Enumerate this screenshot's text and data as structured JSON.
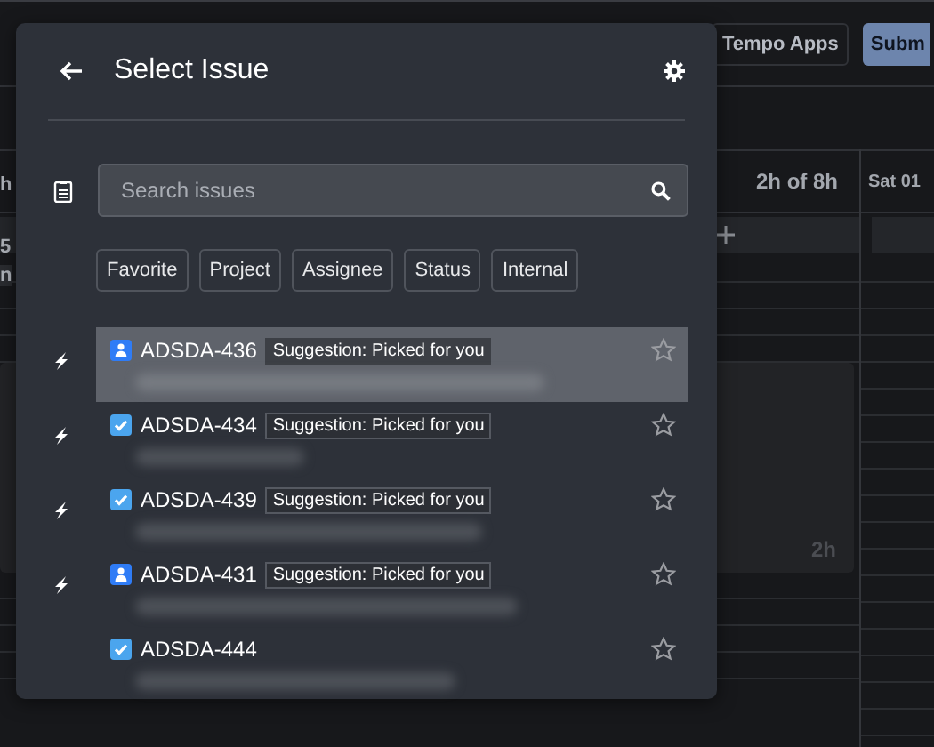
{
  "background": {
    "tempo_button": "Tempo Apps",
    "submit_button": "Subm",
    "left_fragments": [
      "h",
      "5",
      "n"
    ],
    "day_total": "2h of 8h",
    "day_column": "Sat 01",
    "entry_duration": "2h"
  },
  "dialog": {
    "title": "Select Issue",
    "search": {
      "placeholder": "Search issues"
    },
    "filters": [
      "Favorite",
      "Project",
      "Assignee",
      "Status",
      "Internal"
    ],
    "issues": [
      {
        "key": "ADSDA-436",
        "kind": "story",
        "suggested": true,
        "badge": "Suggestion: Picked for you",
        "selected": true,
        "favorite": false
      },
      {
        "key": "ADSDA-434",
        "kind": "task",
        "suggested": true,
        "badge": "Suggestion: Picked for you",
        "selected": false,
        "favorite": false
      },
      {
        "key": "ADSDA-439",
        "kind": "task",
        "suggested": true,
        "badge": "Suggestion: Picked for you",
        "selected": false,
        "favorite": false
      },
      {
        "key": "ADSDA-431",
        "kind": "story",
        "suggested": true,
        "badge": "Suggestion: Picked for you",
        "selected": false,
        "favorite": false
      },
      {
        "key": "ADSDA-444",
        "kind": "task",
        "suggested": false,
        "selected": false,
        "favorite": false
      }
    ]
  }
}
